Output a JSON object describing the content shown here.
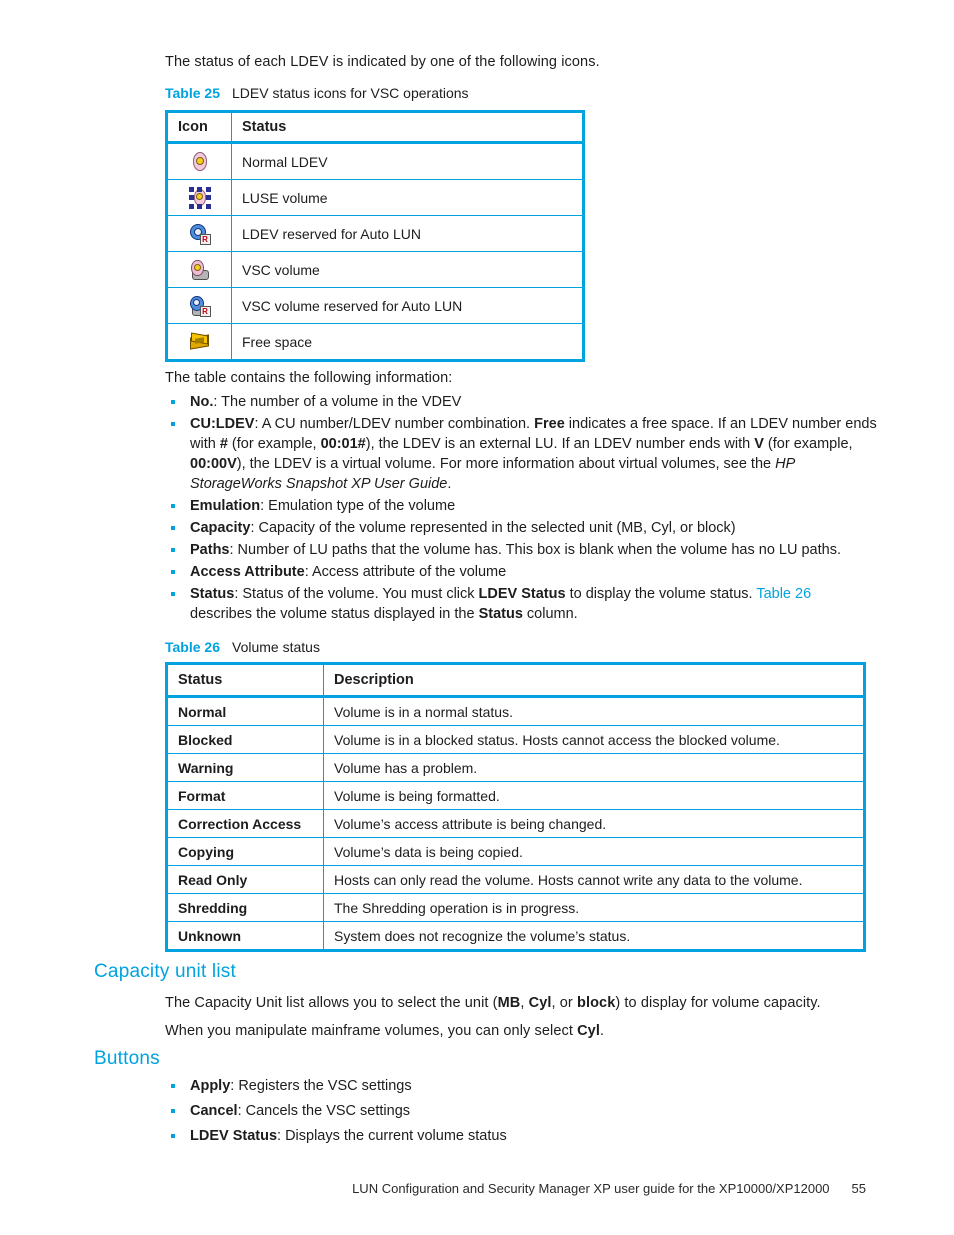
{
  "intro": {
    "line1": "The status of each LDEV is indicated by one of the following icons."
  },
  "table25": {
    "caption_number": "Table 25",
    "caption_text": "LDEV status icons for VSC operations",
    "headers": [
      "Icon",
      "Status"
    ],
    "rows": [
      {
        "icon": "normal-ldev-icon",
        "status": "Normal LDEV"
      },
      {
        "icon": "luse-volume-icon",
        "status": "LUSE volume"
      },
      {
        "icon": "ldev-reserved-auto-lun-icon",
        "status": "LDEV reserved for Auto LUN"
      },
      {
        "icon": "vsc-volume-icon",
        "status": "VSC volume"
      },
      {
        "icon": "vsc-volume-reserved-auto-lun-icon",
        "status": "VSC volume reserved for Auto LUN"
      },
      {
        "icon": "free-space-icon",
        "status": "Free space"
      }
    ]
  },
  "table_info": {
    "lead": "The table contains the following information:",
    "items": [
      {
        "term": "No.",
        "rest": ": The number of a volume in the VDEV"
      },
      {
        "term": "CU:LDEV",
        "rest": ": A CU number/LDEV number combination. Free indicates a free space. If an LDEV number ends with # (for example, 00:01#), the LDEV is an external LU. If an LDEV number ends with V (for example, 00:00V), the LDEV is a virtual volume. For more information about virtual volumes, see the HP StorageWorks Snapshot XP User Guide."
      },
      {
        "term": "Emulation",
        "rest": ": Emulation type of the volume"
      },
      {
        "term": "Capacity",
        "rest": ": Capacity of the volume represented in the selected unit (MB, Cyl, or block)"
      },
      {
        "term": "Paths",
        "rest": ": Number of LU paths that the volume has. This box is blank when the volume has no LU paths."
      },
      {
        "term": "Access Attribute",
        "rest": ": Access attribute of the volume"
      },
      {
        "term": "Status",
        "rest": ": Status of the volume. You must click LDEV Status to display the volume status. Table 26 describes the volume status displayed in the Status column."
      }
    ]
  },
  "table26": {
    "caption_number": "Table 26",
    "caption_text": "Volume status",
    "headers": [
      "Status",
      "Description"
    ],
    "rows": [
      {
        "status": "Normal",
        "description": "Volume is in a normal status."
      },
      {
        "status": "Blocked",
        "description": "Volume is in a blocked status. Hosts cannot access the blocked volume."
      },
      {
        "status": "Warning",
        "description": "Volume has a problem."
      },
      {
        "status": "Format",
        "description": "Volume is being formatted."
      },
      {
        "status": "Correction Access",
        "description": "Volume’s access attribute is being changed."
      },
      {
        "status": "Copying",
        "description": "Volume’s data is being copied."
      },
      {
        "status": "Read Only",
        "description": "Hosts can only read the volume. Hosts cannot write any data to the volume."
      },
      {
        "status": "Shredding",
        "description": "The Shredding operation is in progress."
      },
      {
        "status": "Unknown",
        "description": "System does not recognize the volume’s status."
      }
    ]
  },
  "capacity_unit_list": {
    "heading": "Capacity unit list",
    "para1": "The Capacity Unit list allows you to select the unit (MB, Cyl, or block) to display for volume capacity.",
    "para2": "When you manipulate mainframe volumes, you can only select Cyl."
  },
  "buttons_section": {
    "heading": "Buttons",
    "items": [
      {
        "term": "Apply",
        "rest": ": Registers the VSC settings"
      },
      {
        "term": "Cancel",
        "rest": ": Cancels the VSC settings"
      },
      {
        "term": "LDEV Status",
        "rest": ": Displays the current volume status"
      }
    ]
  },
  "footer": {
    "text": "LUN Configuration and Security Manager XP user guide for the XP10000/XP12000",
    "page_number": "55"
  },
  "colors": {
    "accent": "#00a3e0",
    "text": "#1d1d1d"
  }
}
